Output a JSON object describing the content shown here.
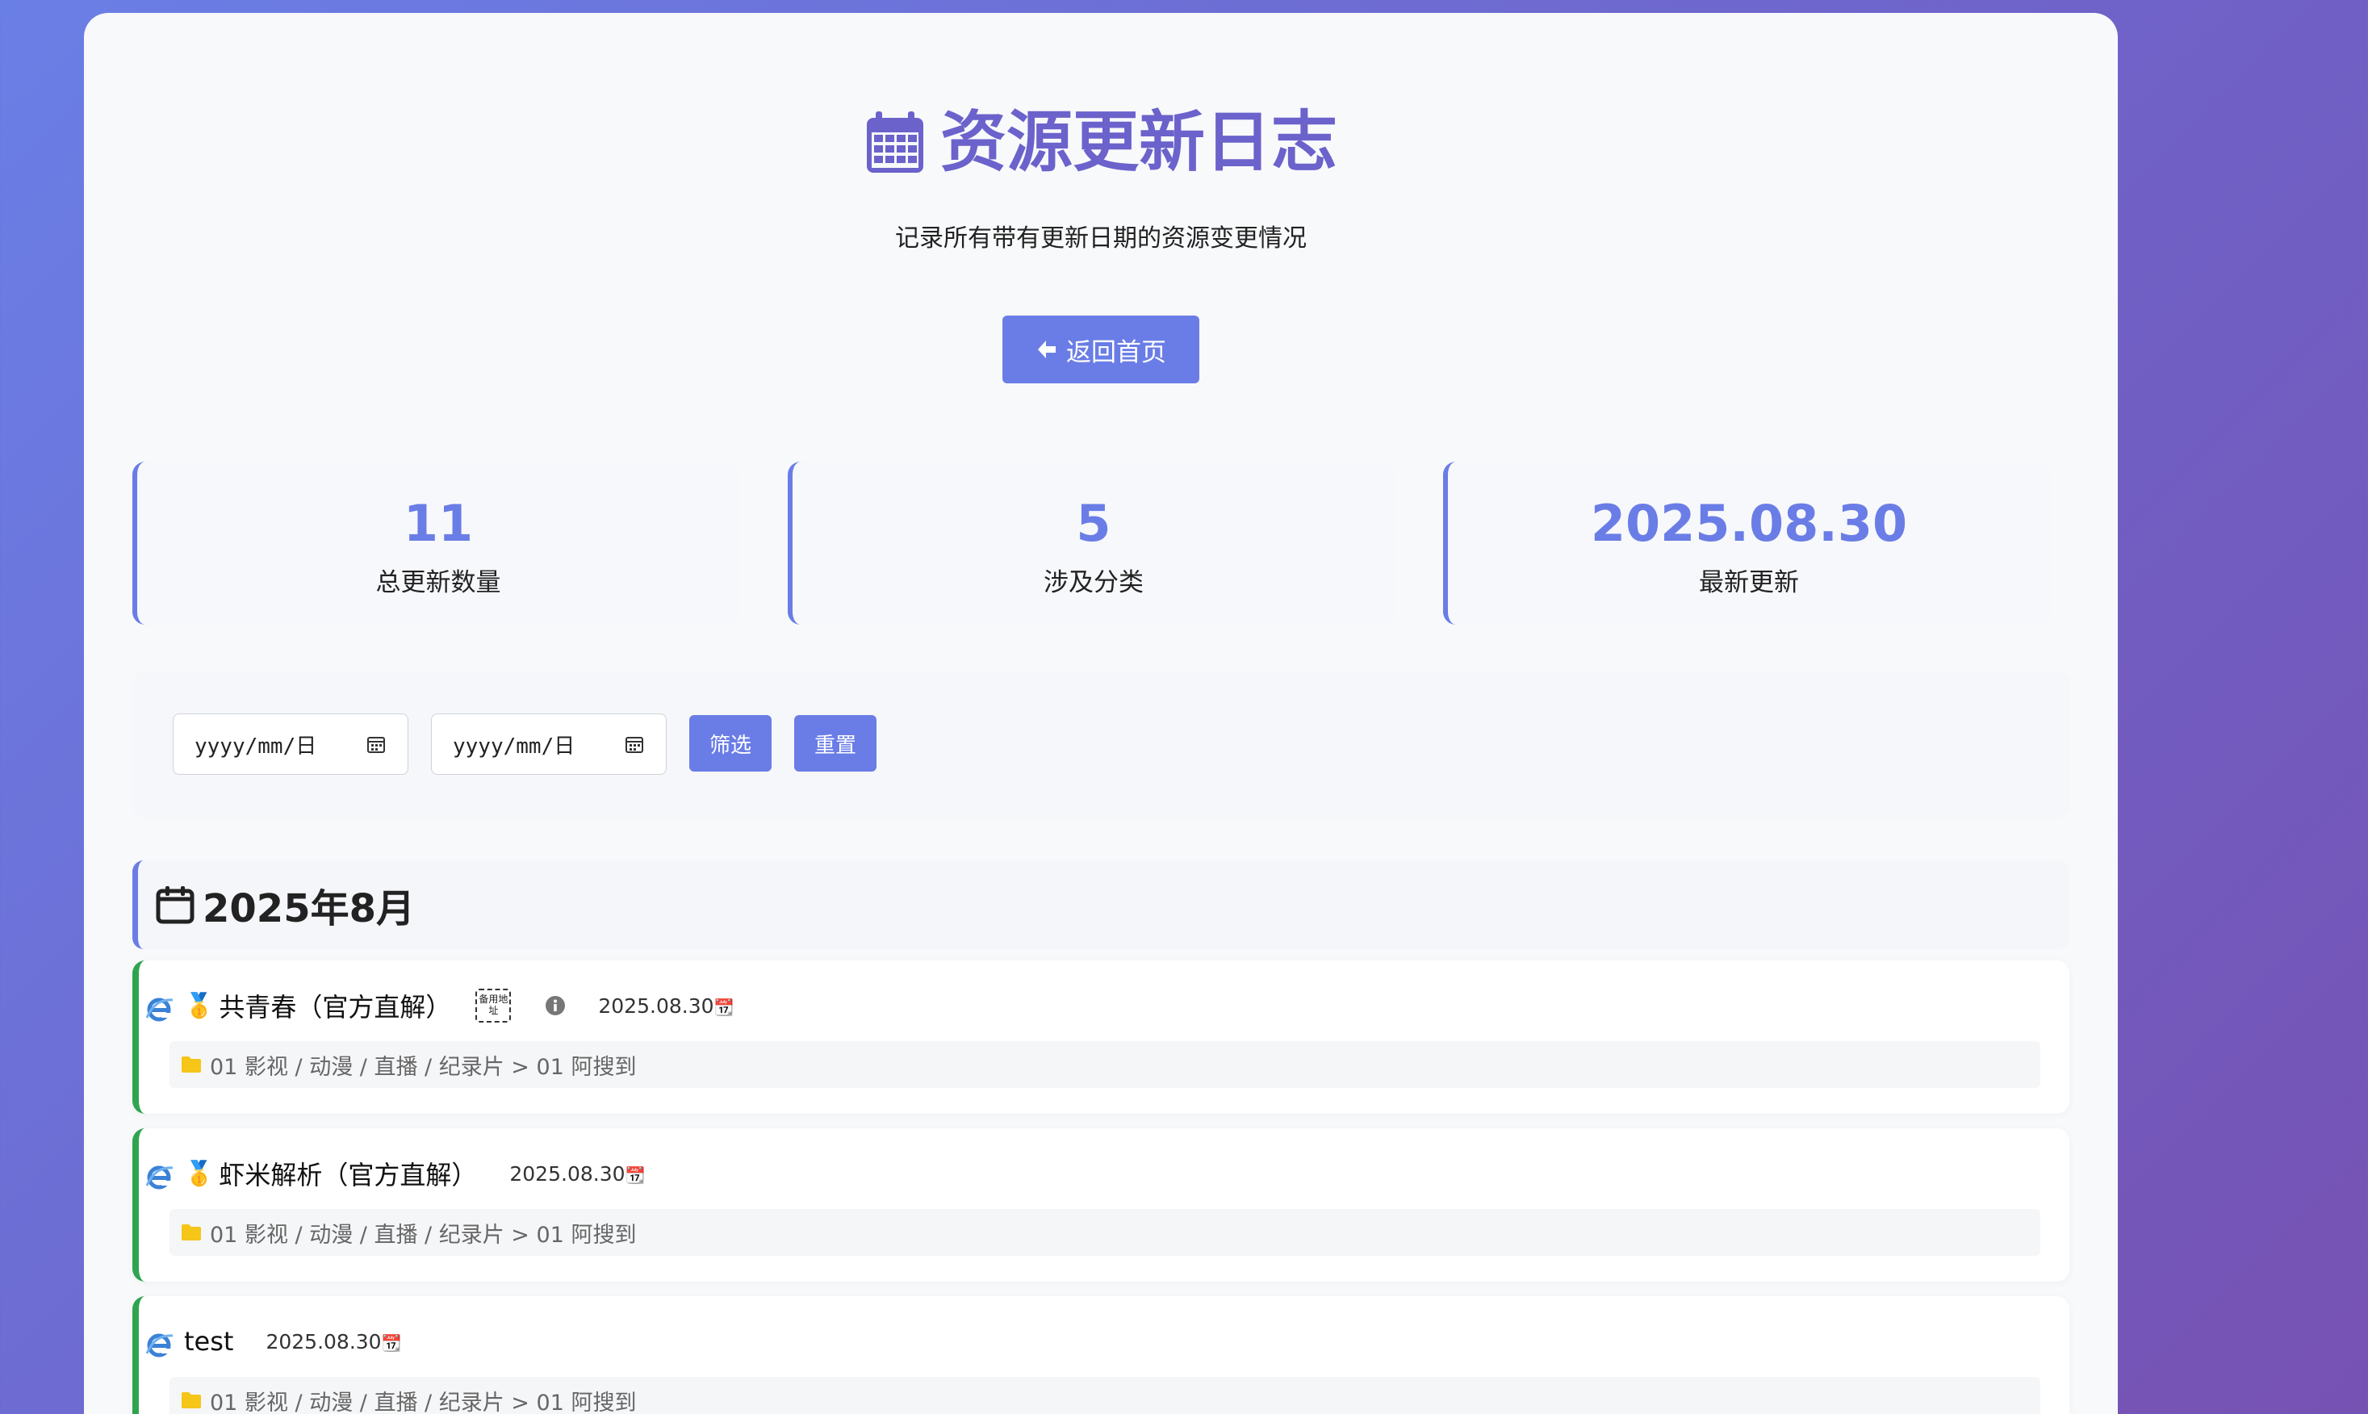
{
  "header": {
    "title": "资源更新日志",
    "subtitle": "记录所有带有更新日期的资源变更情况",
    "icon": "calendar-icon"
  },
  "back_button": {
    "label": "返回首页",
    "icon": "arrow-left-icon"
  },
  "stats": [
    {
      "value": "11",
      "label": "总更新数量"
    },
    {
      "value": "5",
      "label": "涉及分类"
    },
    {
      "value": "2025.08.30",
      "label": "最新更新"
    }
  ],
  "filter": {
    "start_placeholder": "yyyy/mm/日",
    "end_placeholder": "yyyy/mm/日",
    "filter_label": "筛选",
    "reset_label": "重置"
  },
  "month": {
    "label": "2025年8月",
    "icon": "calendar-icon"
  },
  "items": [
    {
      "name": "共青春（官方直解）",
      "medal": "🥇",
      "badge": "备用地址",
      "date": "2025.08.30",
      "path": "01 影视 / 动漫 / 直播 / 纪录片 > 01 阿搜到"
    },
    {
      "name": "虾米解析（官方直解）",
      "medal": "🥇",
      "date": "2025.08.30",
      "path": "01 影视 / 动漫 / 直播 / 纪录片 > 01 阿搜到"
    },
    {
      "name": "test",
      "date": "2025.08.30",
      "path": "01 影视 / 动漫 / 直播 / 纪录片 > 01 阿搜到"
    }
  ],
  "colors": {
    "accent": "#6a7de6",
    "title": "#6b62cb",
    "item_border": "#2fa44f"
  }
}
